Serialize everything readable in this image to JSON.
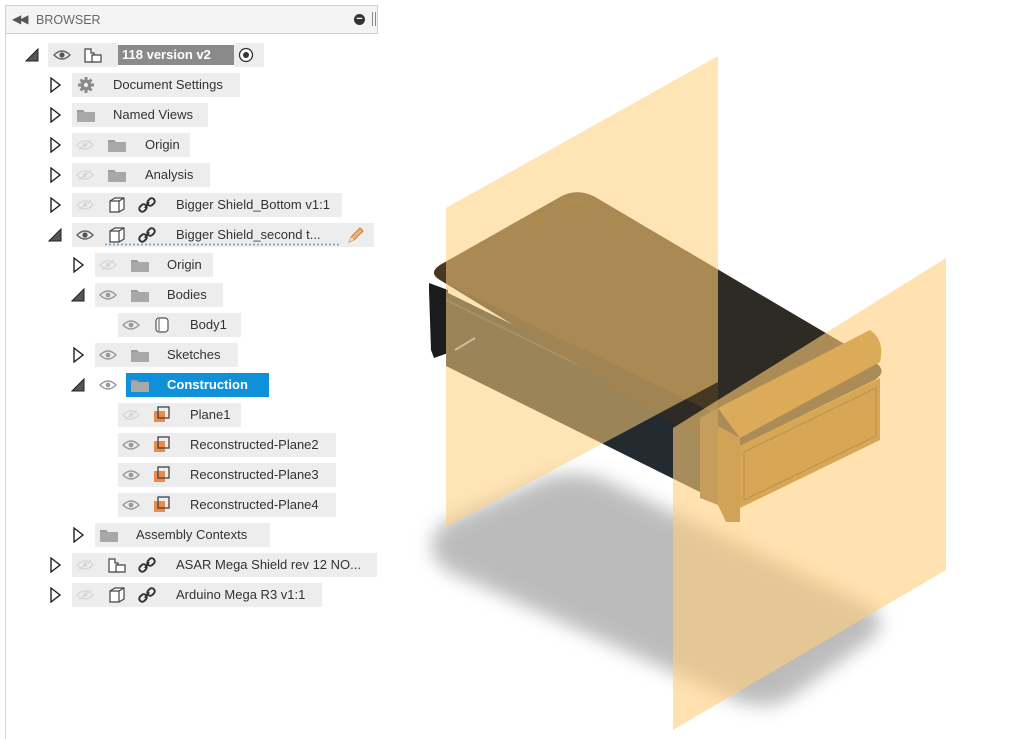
{
  "panel": {
    "title": "BROWSER"
  },
  "tree": {
    "root": {
      "label": "118 version v2"
    },
    "document_settings": "Document Settings",
    "named_views": "Named Views",
    "origin": "Origin",
    "analysis": "Analysis",
    "bottom_component": "Bigger Shield_Bottom v1:1",
    "second_component": "Bigger Shield_second t...",
    "child_origin": "Origin",
    "bodies": "Bodies",
    "body1": "Body1",
    "sketches": "Sketches",
    "construction": "Construction",
    "plane1": "Plane1",
    "plane2": "Reconstructed-Plane2",
    "plane3": "Reconstructed-Plane3",
    "plane4": "Reconstructed-Plane4",
    "assembly_contexts": "Assembly Contexts",
    "asar_component": "ASAR Mega Shield rev 12 NO...",
    "arduino_component": "Arduino Mega R3 v1:1"
  },
  "colors": {
    "selection": "#0e91d9",
    "node_bg": "#ededed",
    "plane_fill": "#ffce7a",
    "body_dark": "#3e3320",
    "body_orange": "#9c6b1e"
  }
}
